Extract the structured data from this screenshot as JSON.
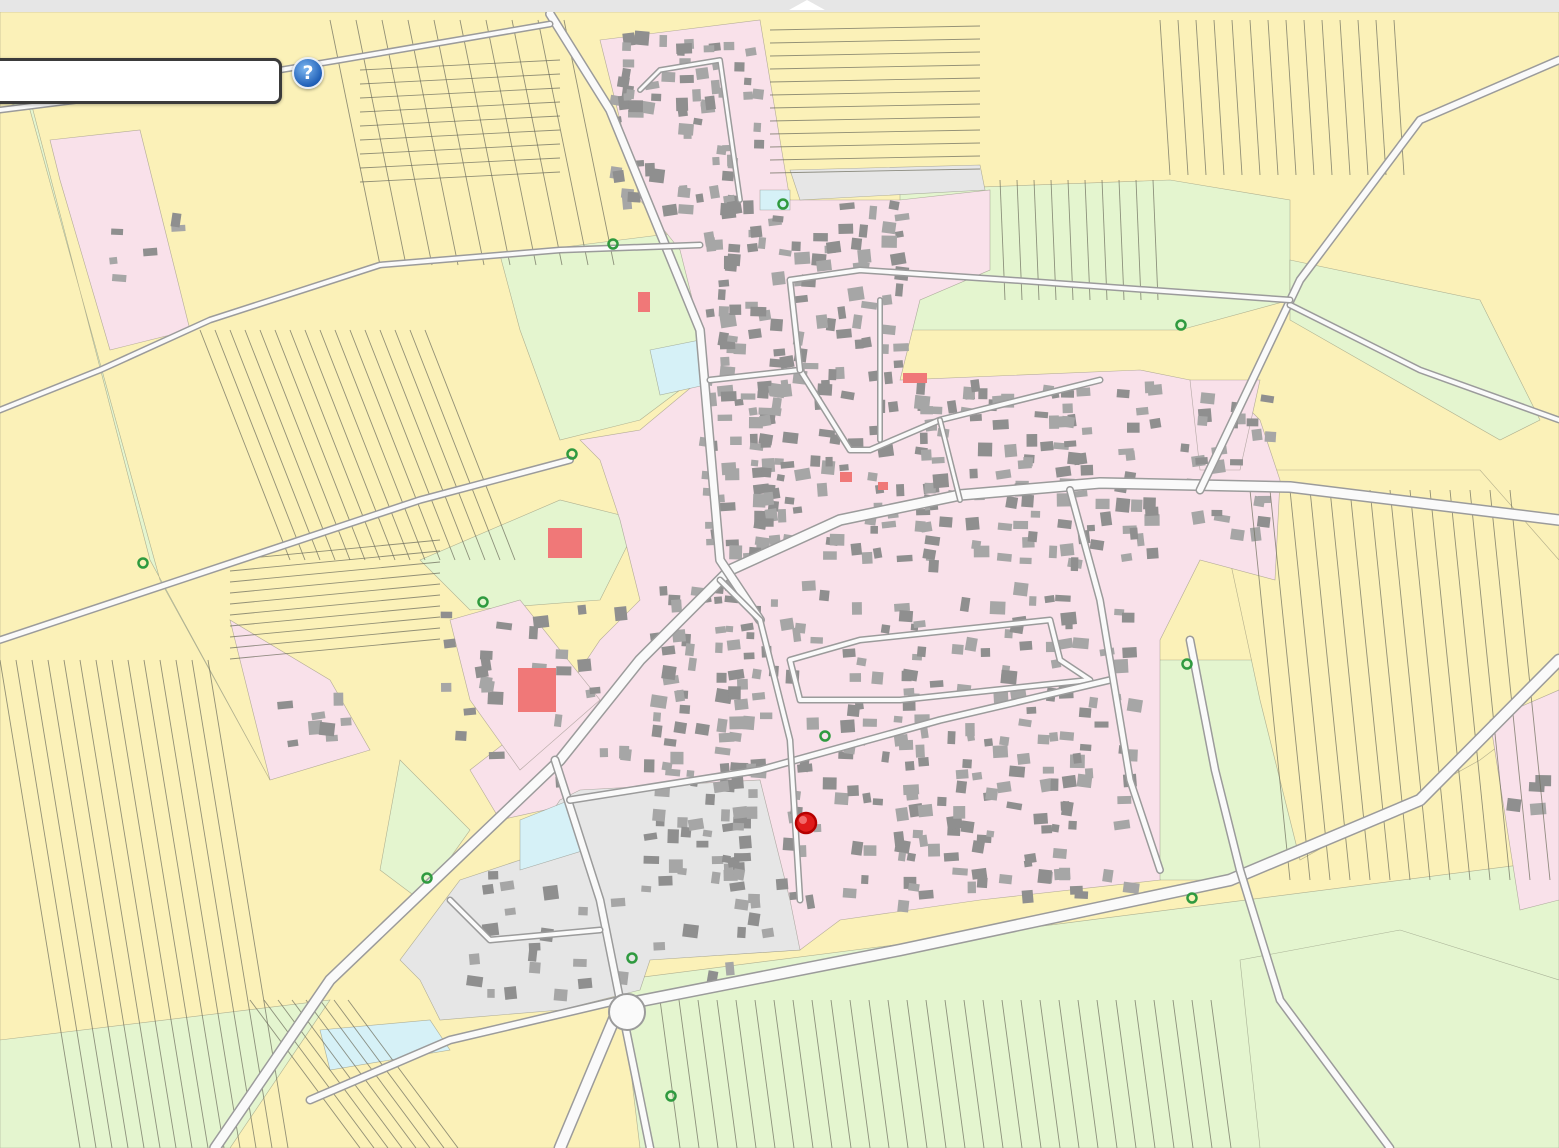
{
  "search": {
    "placeholder": "",
    "value": ""
  },
  "help_button": {
    "icon": "help-icon",
    "glyph": "?"
  },
  "colors": {
    "field": "#fbf1b8",
    "meadow": "#e4f5cf",
    "residential": "#f9e1ea",
    "commercial": "#e6e6e6",
    "water": "#d6f1f7",
    "building": "#a6a6a6",
    "building_dark": "#8f8f8f",
    "building_highlight": "#f07878",
    "road": "#fafafa",
    "road_edge": "#9b9b9b",
    "parcel_line": "#6f6f5f",
    "tree_marker": "#2f9a3f",
    "location_marker": "#e01b1b"
  },
  "markers": {
    "tree_marker_icon": "tree-point-icon",
    "location_marker_icon": "selected-location-icon"
  }
}
